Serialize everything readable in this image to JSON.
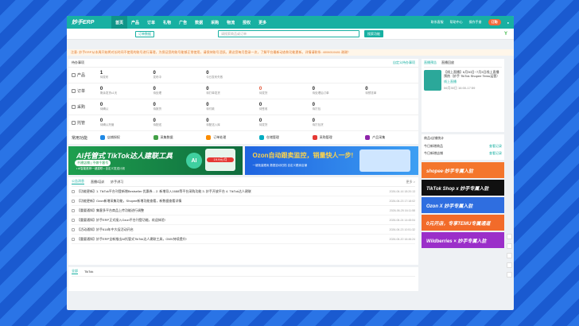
{
  "app": {
    "logo": "妙手ERP",
    "nav": [
      "首页",
      "产品",
      "订单",
      "礼物",
      "广告",
      "数据",
      "采购",
      "物流",
      "授权",
      "更多"
    ],
    "right": [
      "联系客服",
      "帮助中心",
      "操作手册",
      "订购"
    ]
  },
  "search": {
    "app_btn": "订单数据",
    "placeholder": "请搜索商品或订单",
    "go": "搜索功能"
  },
  "notice": "注意: 妙手ERP从本周开始将对长时间不使用的账号进行清理，为保证您的账号能够正常使用，请保持账号活跃。建议您每月登录一次，了解平台最新动态和功能更新。详情请联系: 4006010481 谢谢！",
  "todo": {
    "title": "待办事项",
    "more": "自定义待办事项",
    "rows": [
      {
        "label": "产品",
        "cells": [
          [
            "1",
            "待发布"
          ],
          [
            "0",
            "发布中"
          ],
          [
            "0",
            "今日发布失败"
          ],
          [
            "",
            ""
          ],
          [
            "",
            ""
          ],
          [
            "",
            ""
          ]
        ]
      },
      {
        "label": "订单",
        "cells": [
          [
            "0",
            "剩余发货≤1天"
          ],
          [
            "0",
            "待处理"
          ],
          [
            "0",
            "待打单发货"
          ],
          [
            "0",
            "待发货"
          ],
          [
            "0",
            "待处理后订单"
          ],
          [
            "0",
            "待预览单"
          ]
        ]
      },
      {
        "label": "采购",
        "cells": [
          [
            "0",
            "待确认"
          ],
          [
            "0",
            "待报货"
          ],
          [
            "0",
            "待付款"
          ],
          [
            "0",
            "待签收"
          ],
          [
            "0",
            "待打包"
          ],
          [
            "",
            ""
          ]
        ]
      },
      {
        "label": "托管",
        "cells": [
          [
            "0",
            "待确认托管"
          ],
          [
            "0",
            "待配送"
          ],
          [
            "0",
            "待配送入库"
          ],
          [
            "0",
            "待发货"
          ],
          [
            "0",
            "待打包货"
          ],
          [
            "",
            ""
          ]
        ]
      }
    ],
    "red_index": [
      1,
      4
    ],
    "tools_label": "常用功能",
    "tools": [
      "店铺授权",
      "采集数据",
      "订单处理",
      "仓储管理",
      "采购管理",
      "产品采集"
    ]
  },
  "banner1": {
    "title": "AI托管式 TikTok达人建联工具",
    "sub": "不建店铺 | 不做千客号",
    "lines": "• AI智能推荐一键建联  • 自定义发送计划",
    "price": "19.9元/月",
    "ai": "AI"
  },
  "banner2": {
    "title": "Ozon自动跟卖监控，",
    "hl": "销量快人一步!",
    "lines": "一键批量跟卖  数据自动归档  自定义跟卖店铺"
  },
  "news": {
    "tabs": [
      "公告消息",
      "直播/培训",
      "妙手讲习"
    ],
    "more": "更多 >",
    "items": [
      [
        "【功能更新】1. TikTok平台刊登新增Bestseller 优惠券... 2. 新增导入1688等平台采购功能 3. 妙手开放平台 4. TikTok达人建联",
        "2026-06-16 18:20:13"
      ],
      [
        "【功能更新】Ozon新增采集功能，Shopee新增功能查看，新数据查看详情",
        "2026-06-23 17:18:02"
      ],
      [
        "【重要通知】集客多平台商品上传功能进行调整",
        "2026-06-25 16:11:58"
      ],
      [
        "【重要通知】妙手ERP正式接入Ozon平台刊登功能，欢迎体验!",
        "2026-06-24 14:45:04"
      ],
      [
        "【活动通知】妙手618年中大促活动开启",
        "2026-06-23 10:51:32"
      ],
      [
        "【重要通知】妙手ERP全新推出AI托管式TikTok达人建联工具，GMV持续提升!",
        "2026-06-20 16:46:24"
      ]
    ]
  },
  "bottom": {
    "tabs": [
      "全部",
      "TikTok"
    ]
  },
  "live": {
    "tabs": [
      "直播预告",
      "直播回放"
    ],
    "title": "【线上直播】6月30日~7月3日线上直播预热（妙手 TikTok Shopee Temu运营）",
    "time": "06月30日 16:00-17:59",
    "tag": "线上直播"
  },
  "stats": {
    "title": "商品/店铺统计",
    "r1": [
      "今日新增商品",
      "查看记录"
    ],
    "r2": [
      "今日新增店铺",
      "查看记录"
    ]
  },
  "promos": [
    "shopee·妙手专属入驻",
    "TikTok Shop x 妙手专属入驻",
    "Ozon X 妙手专属入驻",
    "0元开店，专享TEMU专属通道",
    "Wildberries × 妙手专属入驻"
  ]
}
